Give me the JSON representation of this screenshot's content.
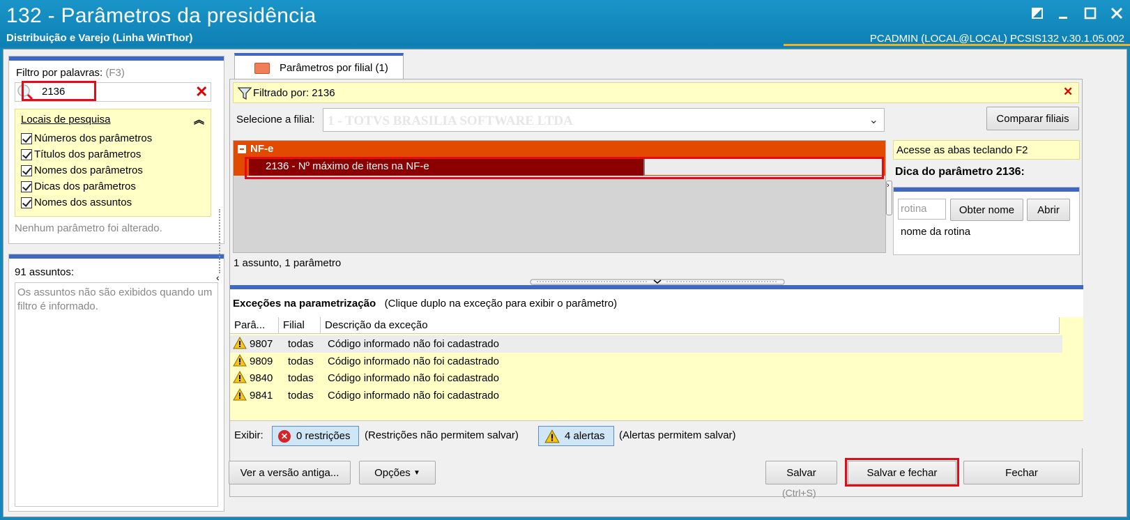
{
  "window": {
    "title": "132 - Parâmetros da presidência",
    "subtitle": "Distribuição e Varejo (Linha WinThor)",
    "user_info": "PCADMIN (LOCAL@LOCAL)   PCSIS132  v.30.1.05.002"
  },
  "filter": {
    "label": "Filtro por palavras:",
    "shortcut": "(F3)",
    "value": "2136",
    "locais_title": "Locais de pesquisa",
    "options": [
      {
        "label": "Números dos parâmetros",
        "checked": true
      },
      {
        "label": "Títulos dos parâmetros",
        "checked": true
      },
      {
        "label": "Nomes dos parâmetros",
        "checked": true
      },
      {
        "label": "Dicas dos parâmetros",
        "checked": true
      },
      {
        "label": "Nomes dos assuntos",
        "checked": true
      }
    ],
    "status": "Nenhum parâmetro foi alterado."
  },
  "assuntos": {
    "title": "91 assuntos:",
    "message": "Os assuntos não são exibidos quando um filtro é informado."
  },
  "tab": {
    "label": "Parâmetros por filial  (1)"
  },
  "filtered": {
    "text": "Filtrado por: 2136"
  },
  "filial": {
    "label": "Selecione a filial:",
    "value": "1 - TOTVS BRASILIA SOFTWARE LTDA",
    "compare_button": "Comparar filiais"
  },
  "tree": {
    "group": "NF-e",
    "item": "2136 - Nº máximo de itens na NF-e",
    "summary": "1 assunto, 1 parâmetro"
  },
  "hint": {
    "access": "Acesse as abas teclando F2",
    "title": "Dica do parâmetro 2136:",
    "rotina_placeholder": "rotina",
    "obter_button": "Obter nome",
    "abrir_button": "Abrir",
    "nome_rotina": "nome da rotina"
  },
  "exceptions": {
    "title": "Exceções na parametrização",
    "subtitle": "(Clique duplo na exceção para exibir o parâmetro)",
    "columns": [
      "Parâ...",
      "Filial",
      "Descrição da exceção"
    ],
    "rows": [
      {
        "param": "9807",
        "filial": "todas",
        "desc": "Código informado não foi cadastrado"
      },
      {
        "param": "9809",
        "filial": "todas",
        "desc": "Código informado não foi cadastrado"
      },
      {
        "param": "9840",
        "filial": "todas",
        "desc": "Código informado não foi cadastrado"
      },
      {
        "param": "9841",
        "filial": "todas",
        "desc": "Código informado não foi cadastrado"
      }
    ]
  },
  "exibir": {
    "label": "Exibir:",
    "restricoes": "0 restrições",
    "restricoes_note": "(Restrições não permitem salvar)",
    "alertas": "4 alertas",
    "alertas_note": "(Alertas permitem salvar)"
  },
  "footer": {
    "versao": "Ver a versão antiga...",
    "opcoes": "Opções",
    "salvar": "Salvar",
    "salvar_shortcut": "(Ctrl+S)",
    "salvar_fechar": "Salvar e fechar",
    "fechar": "Fechar"
  }
}
